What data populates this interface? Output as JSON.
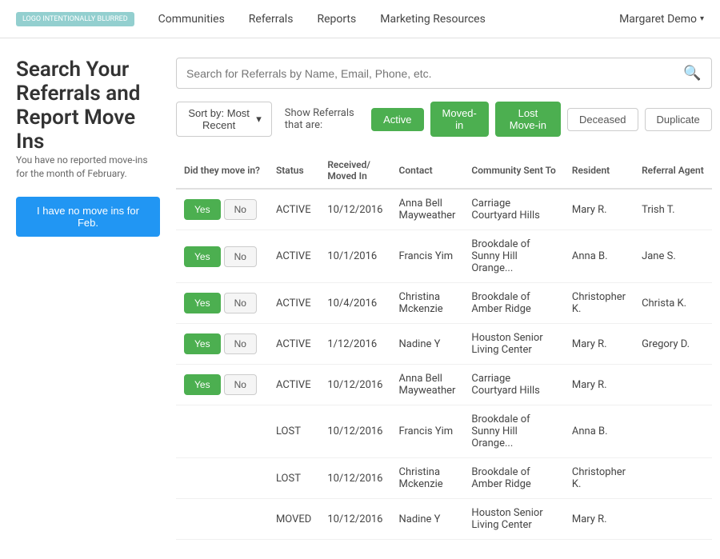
{
  "nav": {
    "logo": "LOGO INTENTIONALLY BLURRED",
    "links": [
      "Communities",
      "Referrals",
      "Reports",
      "Marketing Resources"
    ],
    "user": "Margaret Demo",
    "chevron": "▾"
  },
  "page": {
    "title": "Search Your Referrals and Report Move Ins",
    "sidebar_notice": "You have no reported move-ins for the month of February.",
    "sidebar_btn": "I have no move ins for Feb."
  },
  "search": {
    "placeholder": "Search for Referrals by Name, Email, Phone, etc."
  },
  "filter": {
    "sort_label": "Sort by: Most Recent",
    "show_label": "Show Referrals that are:",
    "buttons": [
      {
        "label": "Active",
        "state": "active"
      },
      {
        "label": "Moved-in",
        "state": "moved-in"
      },
      {
        "label": "Lost Move-in",
        "state": "lost"
      },
      {
        "label": "Deceased",
        "state": "default"
      },
      {
        "label": "Duplicate",
        "state": "default"
      }
    ]
  },
  "table": {
    "headers": [
      "Did they move in?",
      "Status",
      "Received/ Moved In",
      "Contact",
      "Community Sent To",
      "Resident",
      "Referral Agent"
    ],
    "rows": [
      {
        "yes": true,
        "status": "ACTIVE",
        "date": "10/12/2016",
        "contact": "Anna Bell Mayweather",
        "community": "Carriage Courtyard Hills",
        "resident": "Mary R.",
        "agent": "Trish T."
      },
      {
        "yes": true,
        "status": "ACTIVE",
        "date": "10/1/2016",
        "contact": "Francis Yim",
        "community": "Brookdale of Sunny Hill Orange...",
        "resident": "Anna B.",
        "agent": "Jane S."
      },
      {
        "yes": true,
        "status": "ACTIVE",
        "date": "10/4/2016",
        "contact": "Christina Mckenzie",
        "community": "Brookdale of Amber Ridge",
        "resident": "Christopher K.",
        "agent": "Christa K."
      },
      {
        "yes": true,
        "status": "ACTIVE",
        "date": "1/12/2016",
        "contact": "Nadine Y",
        "community": "Houston Senior Living Center",
        "resident": "Mary R.",
        "agent": "Gregory D."
      },
      {
        "yes": true,
        "status": "ACTIVE",
        "date": "10/12/2016",
        "contact": "Anna Bell Mayweather",
        "community": "Carriage Courtyard Hills",
        "resident": "Mary R.",
        "agent": ""
      },
      {
        "yes": false,
        "status": "LOST",
        "date": "10/12/2016",
        "contact": "Francis Yim",
        "community": "Brookdale of Sunny Hill Orange...",
        "resident": "Anna B.",
        "agent": ""
      },
      {
        "yes": false,
        "status": "LOST",
        "date": "10/12/2016",
        "contact": "Christina Mckenzie",
        "community": "Brookdale of Amber Ridge",
        "resident": "Christopher K.",
        "agent": ""
      },
      {
        "yes": false,
        "status": "MOVED",
        "date": "10/12/2016",
        "contact": "Nadine Y",
        "community": "Houston Senior Living Center",
        "resident": "Mary R.",
        "agent": ""
      }
    ]
  }
}
